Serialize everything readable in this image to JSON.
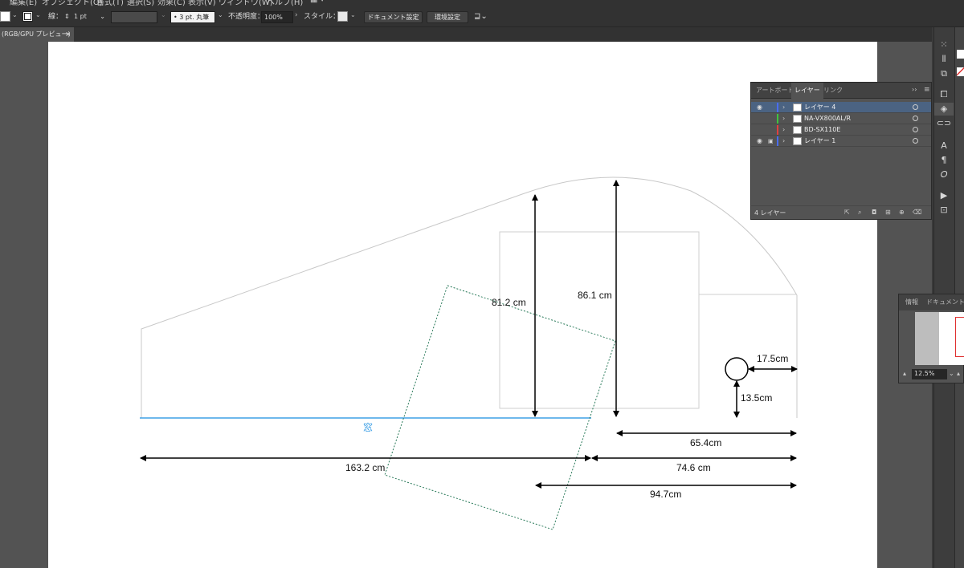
{
  "menubar": {
    "items": [
      "編集(E)",
      "オブジェクト(O)",
      "書式(T)",
      "選択(S)",
      "効果(C)",
      "表示(V)",
      "ウィンドウ(W)",
      "ヘルプ(H)"
    ]
  },
  "controlbar": {
    "stroke_label": "線：",
    "stroke_value": "1 pt",
    "brush_value": "3 pt. 丸筆",
    "opacity_label": "不透明度：",
    "opacity_value": "100%",
    "style_label": "スタイル：",
    "doc_setup_button": "ドキュメント設定",
    "preferences_button": "環境設定"
  },
  "doc_tab": {
    "title": "(RGB/GPU プレビュー)",
    "close": "×"
  },
  "drawing": {
    "window_label": "窓",
    "dim_81_2": "81.2 cm",
    "dim_86_1": "86.1 cm",
    "dim_17_5": "17.5cm",
    "dim_13_5": "13.5cm",
    "dim_65_4": "65.4cm",
    "dim_163_2": "163.2 cm",
    "dim_74_6": "74.6 cm",
    "dim_94_7": "94.7cm",
    "colors": {
      "window_line": "#3ea0e6",
      "rotated_rect": "#2a7a5a",
      "outline": "#c8c8c8",
      "arrows": "#000000"
    }
  },
  "layers_panel": {
    "tabs": [
      "アートボード",
      "レイヤー",
      "リンク"
    ],
    "active_tab": "レイヤー",
    "layers": [
      {
        "name": "レイヤー 4",
        "color": "#4a6cf0",
        "visible": true,
        "locked": false,
        "selected": true
      },
      {
        "name": "NA-VX800AL/R",
        "color": "#3ec43e",
        "visible": false,
        "locked": false,
        "selected": false
      },
      {
        "name": "BD-SX110E",
        "color": "#e04040",
        "visible": false,
        "locked": false,
        "selected": false
      },
      {
        "name": "レイヤー 1",
        "color": "#4a6cf0",
        "visible": true,
        "locked": true,
        "selected": false
      }
    ],
    "count_label": "4 レイヤー"
  },
  "nav_panel": {
    "tab_info": "情報",
    "tab_doc_info": "ドキュメント情報",
    "zoom_value": "12.5%"
  },
  "icons": {
    "eye": "👁",
    "lock": "🔒",
    "chevron": "›",
    "menu": "≡",
    "expand": "››"
  }
}
